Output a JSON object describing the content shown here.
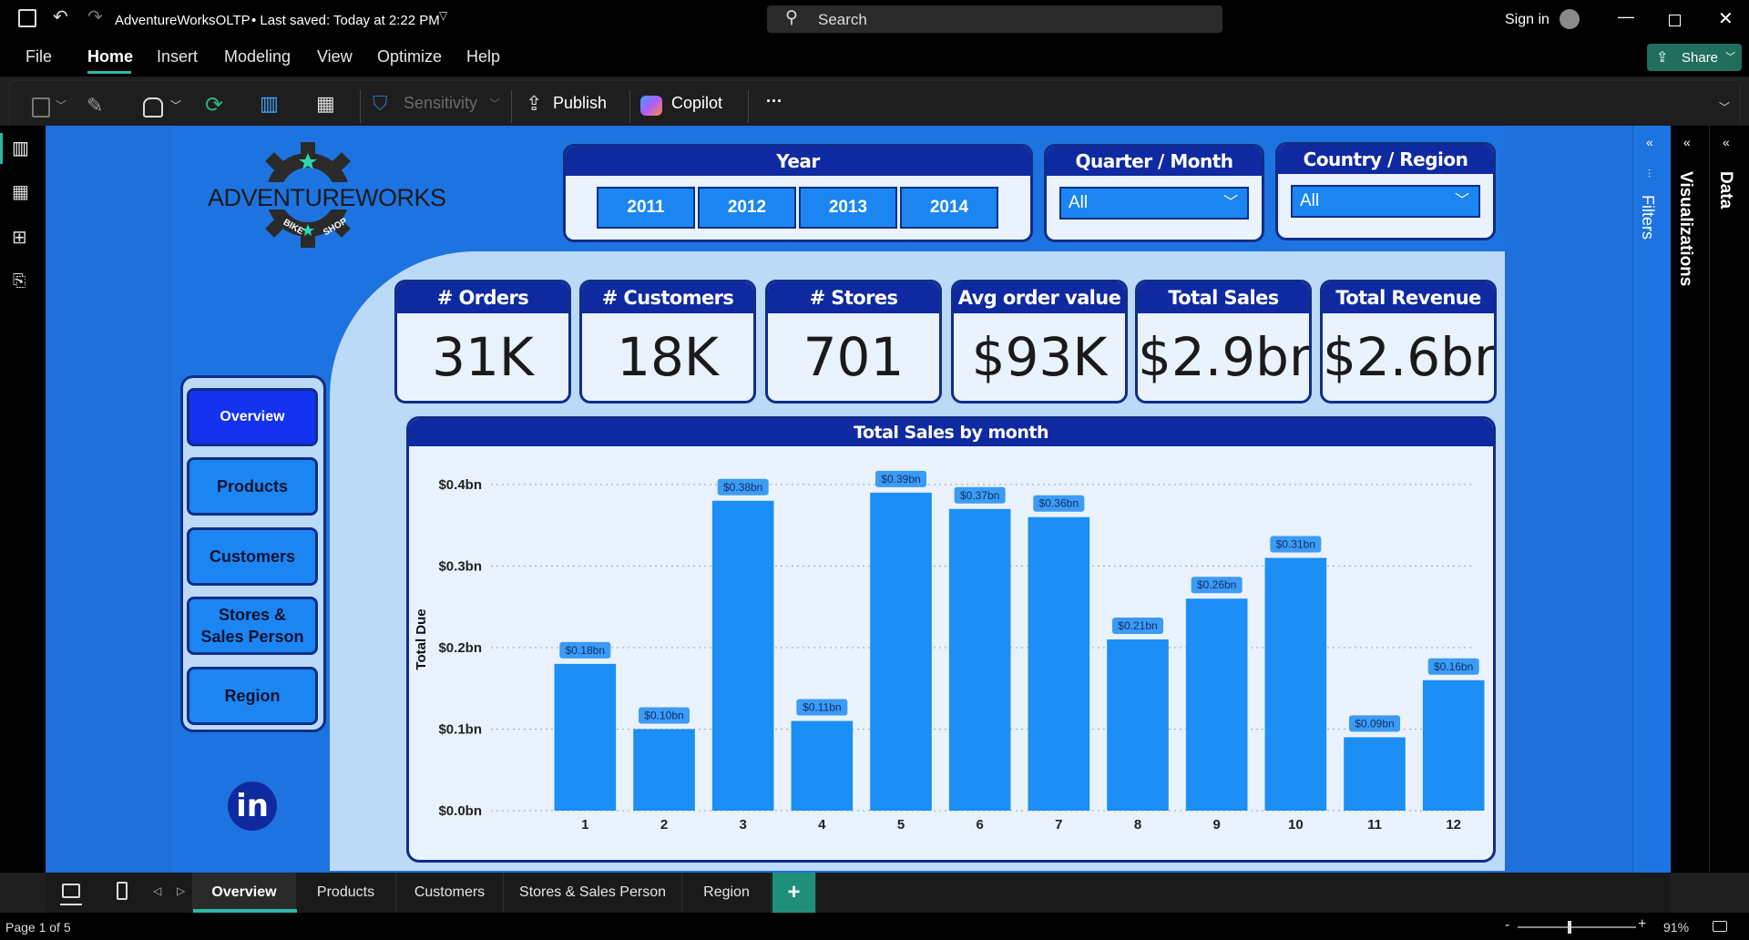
{
  "titlebar": {
    "document_title": "AdventureWorksOLTP",
    "save_status": "• Last saved: Today at 2:22 PM",
    "search_placeholder": "Search",
    "sign_in": "Sign in"
  },
  "menubar": {
    "items": [
      "File",
      "Home",
      "Insert",
      "Modeling",
      "View",
      "Optimize",
      "Help"
    ],
    "active": "Home",
    "share_label": "Share"
  },
  "ribbon": {
    "sensitivity_label": "Sensitivity",
    "publish_label": "Publish",
    "copilot_label": "Copilot",
    "more_label": "···"
  },
  "report": {
    "logo_text": "ADVENTUREWORKS",
    "logo_subtext_left": "BIKE",
    "logo_subtext_right": "SHOP",
    "year_slicer": {
      "title": "Year",
      "options": [
        "2011",
        "2012",
        "2013",
        "2014"
      ]
    },
    "quarter_slicer": {
      "title": "Quarter / Month",
      "value": "All"
    },
    "country_slicer": {
      "title": "Country / Region",
      "value": "All"
    },
    "kpis": [
      {
        "title": "# Orders",
        "value": "31K"
      },
      {
        "title": "# Customers",
        "value": "18K"
      },
      {
        "title": "# Stores",
        "value": "701"
      },
      {
        "title": "Avg order value",
        "value": "$93K"
      },
      {
        "title": "Total Sales",
        "value": "$2.9bn"
      },
      {
        "title": "Total Revenue",
        "value": "$2.6bn"
      }
    ],
    "nav_buttons": [
      "Overview",
      "Products",
      "Customers",
      "Stores & Sales Person",
      "Region"
    ],
    "linkedin_label": "in"
  },
  "chart_data": {
    "type": "bar",
    "title": "Total Sales by month",
    "ylabel": "Total Due",
    "xlabel": "",
    "categories": [
      "1",
      "2",
      "3",
      "4",
      "5",
      "6",
      "7",
      "8",
      "9",
      "10",
      "11",
      "12"
    ],
    "values": [
      0.18,
      0.1,
      0.38,
      0.11,
      0.39,
      0.37,
      0.36,
      0.21,
      0.26,
      0.31,
      0.09,
      0.16
    ],
    "data_labels": [
      "$0.18bn",
      "$0.10bn",
      "$0.38bn",
      "$0.11bn",
      "$0.39bn",
      "$0.37bn",
      "$0.36bn",
      "$0.21bn",
      "$0.26bn",
      "$0.31bn",
      "$0.09bn",
      "$0.16bn"
    ],
    "ytick_labels": [
      "$0.0bn",
      "$0.1bn",
      "$0.2bn",
      "$0.3bn",
      "$0.4bn"
    ],
    "ytick_values": [
      0,
      0.1,
      0.2,
      0.3,
      0.4
    ],
    "ylim": [
      0,
      0.42
    ],
    "grid": true,
    "bar_color": "#1b8ff5"
  },
  "right_panes": {
    "filters": "Filters",
    "visualizations": "Visualizations",
    "data": "Data"
  },
  "page_tabs": {
    "tabs": [
      "Overview",
      "Products",
      "Customers",
      "Stores & Sales Person",
      "Region"
    ],
    "active": "Overview",
    "add_label": "+"
  },
  "statusbar": {
    "page_info": "Page 1 of 5",
    "zoom": "91%"
  },
  "colors": {
    "report_bg": "#1d74e0",
    "header_navy": "#0f2aa0",
    "accent_blue": "#1b86f2",
    "teal_share": "#1f6f5c",
    "tab_active_underline": "#2bb6a3"
  }
}
